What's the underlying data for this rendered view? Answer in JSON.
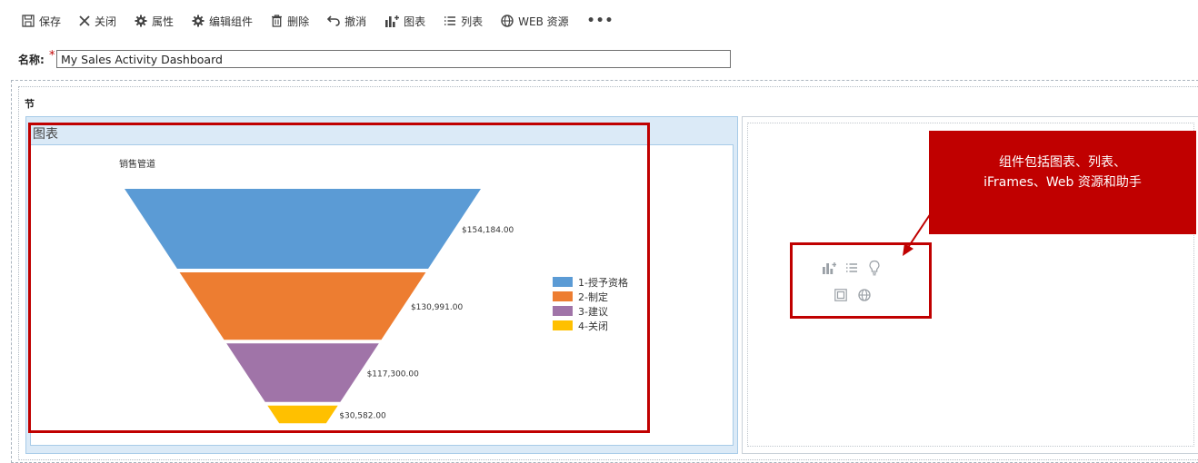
{
  "toolbar": {
    "save_label": "保存",
    "close_label": "关闭",
    "properties_label": "属性",
    "edit_component_label": "编辑组件",
    "delete_label": "删除",
    "undo_label": "撤消",
    "chart_label": "图表",
    "list_label": "列表",
    "web_resource_label": "WEB 资源",
    "more_label": "•••"
  },
  "name_field": {
    "label": "名称:",
    "required_marker": "*",
    "value": "My Sales Activity Dashboard"
  },
  "section": {
    "title": "节"
  },
  "chart_component": {
    "title": "图表"
  },
  "chart_data": {
    "type": "funnel",
    "title": "销售管道",
    "categories": [
      "1-授予资格",
      "2-制定",
      "3-建议",
      "4-关闭"
    ],
    "values": [
      154184.0,
      130991.0,
      117300.0,
      30582.0
    ],
    "value_labels": [
      "$154,184.00",
      "$130,991.00",
      "$117,300.00",
      "$30,582.00"
    ],
    "colors": [
      "#5b9bd5",
      "#ed7d31",
      "#a074a8",
      "#ffc000"
    ],
    "legend_position": "right"
  },
  "callout": {
    "line1": "组件包括图表、列表、",
    "line2": "iFrames、Web 资源和助手"
  },
  "insert_icons": [
    "chart-icon",
    "list-icon",
    "assistant-icon",
    "iframe-icon",
    "web-resource-icon"
  ],
  "colors": {
    "accent_red": "#c00000",
    "component_header": "#dbeaf7",
    "component_border": "#a7cbe8"
  }
}
